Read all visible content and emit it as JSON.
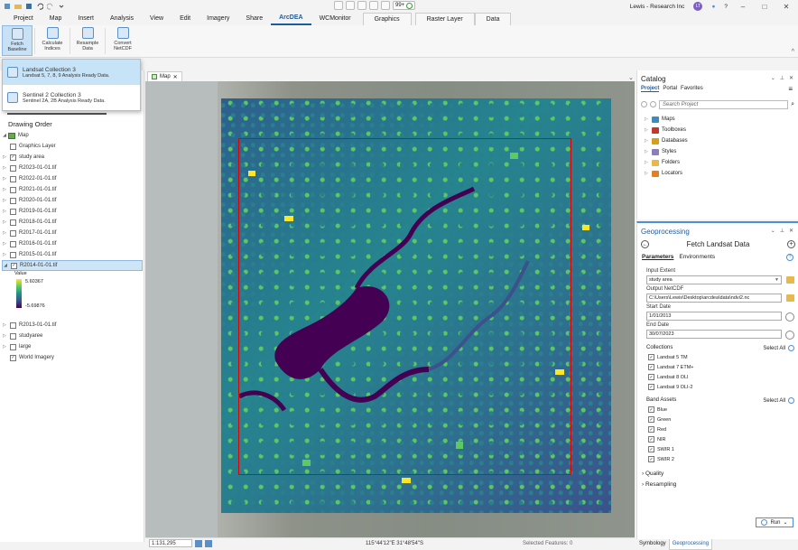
{
  "titlebar": {
    "user": "Lewis - Research Inc",
    "user_initials": "LT",
    "zoom": "99+",
    "help": "?",
    "minimize": "–",
    "maximize": "□",
    "close": "✕"
  },
  "tabs": [
    "Project",
    "Map",
    "Insert",
    "Analysis",
    "View",
    "Edit",
    "Imagery",
    "Share",
    "ArcDEA",
    "WCMonitor"
  ],
  "active_tab": "ArcDEA",
  "context_tabs": [
    "Graphics",
    "Raster Layer",
    "Data"
  ],
  "ribbon": {
    "buttons": [
      {
        "label": "Fetch Baseline"
      },
      {
        "label": "Calculate Indices"
      },
      {
        "label": "Resample Data"
      },
      {
        "label": "Convert NetCDF"
      }
    ]
  },
  "dropdown": {
    "items": [
      {
        "title": "Landsat Collection 3",
        "subtitle": "Landsat 5, 7, 8, 9 Analysis Ready Data."
      },
      {
        "title": "Sentinel 2 Collection 3",
        "subtitle": "Sentinel 2A, 2B Analysis Ready Data."
      }
    ]
  },
  "contents": {
    "heading": "Drawing Order",
    "layers": [
      {
        "name": "Map",
        "type": "map",
        "checked": true
      },
      {
        "name": "Graphics Layer",
        "checked": false
      },
      {
        "name": "study area",
        "checked": true
      },
      {
        "name": "R2023-01-01.tif",
        "checked": false
      },
      {
        "name": "R2022-01-01.tif",
        "checked": false
      },
      {
        "name": "R2021-01-01.tif",
        "checked": false
      },
      {
        "name": "R2020-01-01.tif",
        "checked": false
      },
      {
        "name": "R2019-01-01.tif",
        "checked": false
      },
      {
        "name": "R2018-01-01.tif",
        "checked": false
      },
      {
        "name": "R2017-01-01.tif",
        "checked": false
      },
      {
        "name": "R2016-01-01.tif",
        "checked": false
      },
      {
        "name": "R2015-01-01.tif",
        "checked": false
      },
      {
        "name": "R2014-01-01.tif",
        "checked": true,
        "selected": true
      }
    ],
    "legend": {
      "label": "Value",
      "high": "5.60367",
      "low": "-5.69876"
    },
    "layers_after": [
      {
        "name": "R2013-01-01.tif",
        "checked": false
      },
      {
        "name": "studyaree",
        "checked": false
      },
      {
        "name": "large",
        "checked": false
      },
      {
        "name": "World Imagery",
        "checked": true
      }
    ]
  },
  "map": {
    "tab": "Map",
    "scale": "1:131,295",
    "coords": "115°44'12\"E 31°48'54\"S",
    "selected_features": "Selected Features: 0"
  },
  "catalog": {
    "title": "Catalog",
    "tabs": [
      "Project",
      "Portal",
      "Favorites"
    ],
    "search_placeholder": "Search Project",
    "items": [
      {
        "label": "Maps",
        "color": "#3c8dbc"
      },
      {
        "label": "Toolboxes",
        "color": "#c0392b"
      },
      {
        "label": "Databases",
        "color": "#d4a017"
      },
      {
        "label": "Styles",
        "color": "#8e7cc3"
      },
      {
        "label": "Folders",
        "color": "#e8b84a"
      },
      {
        "label": "Locators",
        "color": "#e67e22"
      }
    ]
  },
  "geoprocessing": {
    "title": "Geoprocessing",
    "tool": "Fetch Landsat Data",
    "tabs": [
      "Parameters",
      "Environments"
    ],
    "input_extent_label": "Input Extent",
    "input_extent": "study area",
    "output_label": "Output NetCDF",
    "output": "C:\\Users\\Lewis\\Desktop\\arcdea\\data\\ndvi2.nc",
    "start_label": "Start Date",
    "start": "1/01/2013",
    "end_label": "End Date",
    "end": "30/07/2023",
    "collections_label": "Collections",
    "select_all": "Select All",
    "collections": [
      "Landsat 5 TM",
      "Landsat 7 ETM+",
      "Landsat 8 OLI",
      "Landsat 9 OLI-2"
    ],
    "bands_label": "Band Assets",
    "bands": [
      "Blue",
      "Green",
      "Red",
      "NIR",
      "SWIR 1",
      "SWIR 2"
    ],
    "quality": "Quality",
    "resampling": "Resampling",
    "run": "Run"
  },
  "bottom_tabs": [
    "Symbology",
    "Geoprocessing"
  ]
}
